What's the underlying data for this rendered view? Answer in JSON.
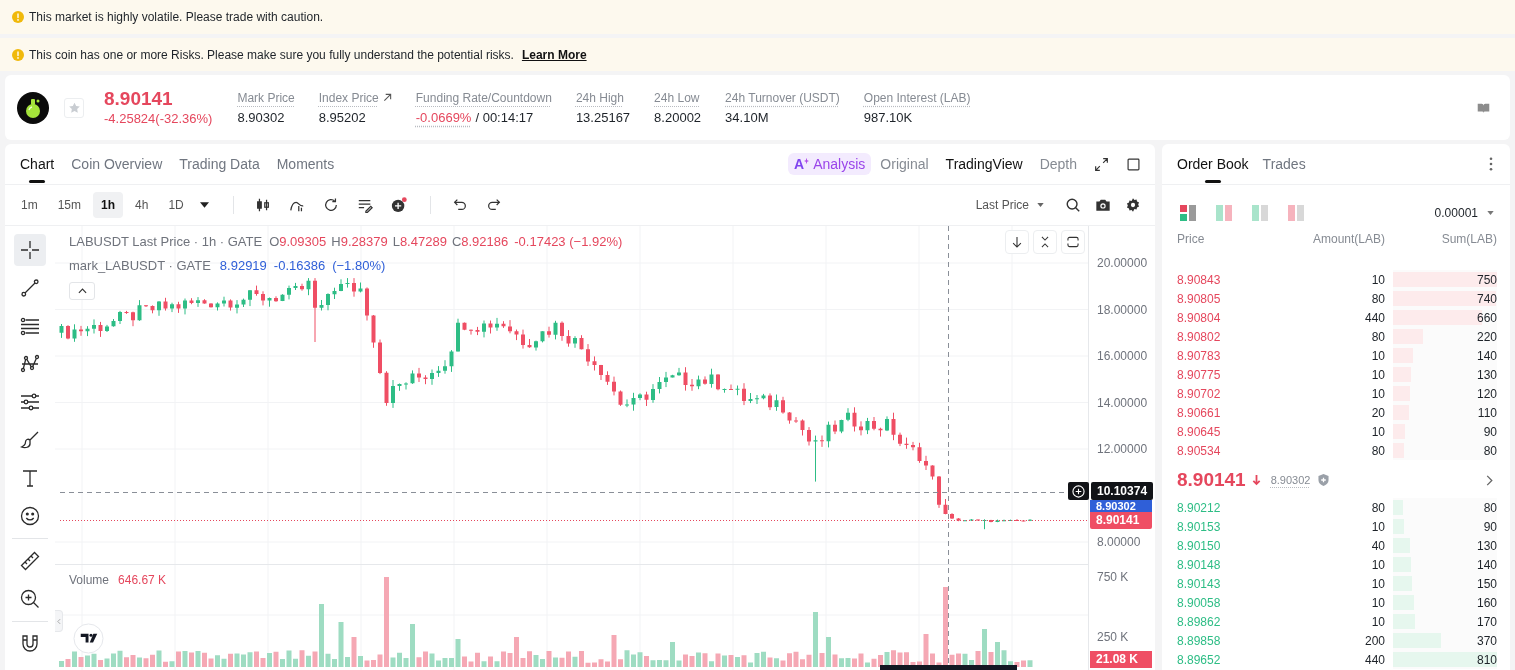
{
  "banners": [
    {
      "text": "This market is highly volatile. Please trade with caution."
    },
    {
      "text": "This coin has one or more Risks. Please make sure you fully understand the potential risks.",
      "link": "Learn More"
    }
  ],
  "ticker": {
    "favorite": false,
    "last_price": "8.90141",
    "change": "-4.25824(-32.36%)",
    "falling": true,
    "stats": [
      {
        "kind": "plain",
        "label": "Mark Price",
        "value": "8.90302"
      },
      {
        "kind": "link",
        "label": "Index Price",
        "value": "8.95202"
      },
      {
        "kind": "funding",
        "label": "Funding Rate/Countdown",
        "rate": "-0.0669%",
        "countdown": "/ 00:14:17"
      },
      {
        "kind": "plain",
        "label": "24h High",
        "value": "13.25167"
      },
      {
        "kind": "plain",
        "label": "24h Low",
        "value": "8.20002"
      },
      {
        "kind": "plain",
        "label": "24h Turnover (USDT)",
        "value": "34.10M"
      },
      {
        "kind": "plain",
        "label": "Open Interest (LAB)",
        "value": "987.10K"
      }
    ]
  },
  "chart_tabs": [
    {
      "label": "Chart",
      "selected": true
    },
    {
      "label": "Coin Overview",
      "selected": false
    },
    {
      "label": "Trading Data",
      "selected": false
    },
    {
      "label": "Moments",
      "selected": false
    }
  ],
  "analysis": {
    "icon_text": "A",
    "label": "Analysis"
  },
  "view_tabs": [
    {
      "label": "Original",
      "selected": false
    },
    {
      "label": "TradingView",
      "selected": true
    },
    {
      "label": "Depth",
      "selected": false
    }
  ],
  "intervals": [
    {
      "label": "1m",
      "selected": false
    },
    {
      "label": "15m",
      "selected": false
    },
    {
      "label": "1h",
      "selected": true
    },
    {
      "label": "4h",
      "selected": false
    },
    {
      "label": "1D",
      "selected": false
    }
  ],
  "toolbar": {
    "new_badge": true,
    "price_type": "Last Price"
  },
  "tool_groups": [
    {
      "tools": [
        {
          "kind": "crosshair",
          "selected": true
        },
        {
          "kind": "line",
          "selected": false
        },
        {
          "kind": "channel",
          "selected": false
        },
        {
          "kind": "pattern",
          "selected": false
        },
        {
          "kind": "projection",
          "selected": false
        },
        {
          "kind": "brush",
          "selected": false
        },
        {
          "kind": "text",
          "selected": false
        },
        {
          "kind": "emoji",
          "selected": false
        }
      ]
    },
    {
      "tools": [
        {
          "kind": "ruler",
          "selected": false
        },
        {
          "kind": "zoom",
          "selected": false
        }
      ]
    },
    {
      "tools": [
        {
          "kind": "magnet",
          "selected": false
        }
      ]
    }
  ],
  "chart": {
    "legend": {
      "symbol": "LABUSDT Last Price · 1h · GATE",
      "ohlc": [
        {
          "label": "O",
          "value": "9.09305"
        },
        {
          "label": "H",
          "value": "9.28379"
        },
        {
          "label": "L",
          "value": "8.47289"
        },
        {
          "label": "C",
          "value": "8.92186"
        }
      ],
      "change": "-0.17423 (−1.92%)",
      "falling": true
    },
    "mark_legend": {
      "symbol": "mark_LABUSDT · GATE",
      "value": "8.92919",
      "change": "-0.16386",
      "percent": "(−1.80%)"
    },
    "price_axis": [
      "20.00000",
      "18.00000",
      "16.00000",
      "14.00000",
      "12.00000",
      "8.00000"
    ],
    "crosshair_price": "10.10374",
    "mark_price_tag": "8.90302",
    "last_price_tag": "8.90141",
    "volume_legend": {
      "label": "Volume",
      "value": "646.67 K"
    },
    "volume_axis": [
      "750 K",
      "250 K"
    ],
    "volume_tag": "21.08 K"
  },
  "order_book": {
    "tabs": [
      {
        "label": "Order Book",
        "selected": true
      },
      {
        "label": "Trades",
        "selected": false
      }
    ],
    "layouts": [
      {
        "kind": "all",
        "selected": true
      },
      {
        "kind": "split",
        "selected": false
      },
      {
        "kind": "bids",
        "selected": false
      },
      {
        "kind": "asks",
        "selected": false
      }
    ],
    "precision": "0.00001",
    "columns": [
      "Price",
      "Amount(LAB)",
      "Sum(LAB)"
    ],
    "asks": [
      {
        "price": "8.90843",
        "amount": "10",
        "sum": "750",
        "level": 1.0
      },
      {
        "price": "8.90805",
        "amount": "80",
        "sum": "740",
        "level": 0.99
      },
      {
        "price": "8.90804",
        "amount": "440",
        "sum": "660",
        "level": 0.86
      },
      {
        "price": "8.90802",
        "amount": "80",
        "sum": "220",
        "level": 0.29
      },
      {
        "price": "8.90783",
        "amount": "10",
        "sum": "140",
        "level": 0.19
      },
      {
        "price": "8.90775",
        "amount": "10",
        "sum": "130",
        "level": 0.17
      },
      {
        "price": "8.90702",
        "amount": "10",
        "sum": "120",
        "level": 0.16
      },
      {
        "price": "8.90661",
        "amount": "20",
        "sum": "110",
        "level": 0.15
      },
      {
        "price": "8.90645",
        "amount": "10",
        "sum": "90",
        "level": 0.12
      },
      {
        "price": "8.90534",
        "amount": "80",
        "sum": "80",
        "level": 0.11
      }
    ],
    "last_price": "8.90141",
    "falling": true,
    "mark_price": "8.90302",
    "bids": [
      {
        "price": "8.90212",
        "amount": "80",
        "sum": "80",
        "level": 0.1
      },
      {
        "price": "8.90153",
        "amount": "10",
        "sum": "90",
        "level": 0.11
      },
      {
        "price": "8.90150",
        "amount": "40",
        "sum": "130",
        "level": 0.16
      },
      {
        "price": "8.90148",
        "amount": "10",
        "sum": "140",
        "level": 0.17
      },
      {
        "price": "8.90143",
        "amount": "10",
        "sum": "150",
        "level": 0.18
      },
      {
        "price": "8.90058",
        "amount": "10",
        "sum": "160",
        "level": 0.2
      },
      {
        "price": "8.89862",
        "amount": "10",
        "sum": "170",
        "level": 0.21
      },
      {
        "price": "8.89858",
        "amount": "200",
        "sum": "370",
        "level": 0.46
      },
      {
        "price": "8.89652",
        "amount": "440",
        "sum": "810",
        "level": 1.0
      }
    ]
  }
}
